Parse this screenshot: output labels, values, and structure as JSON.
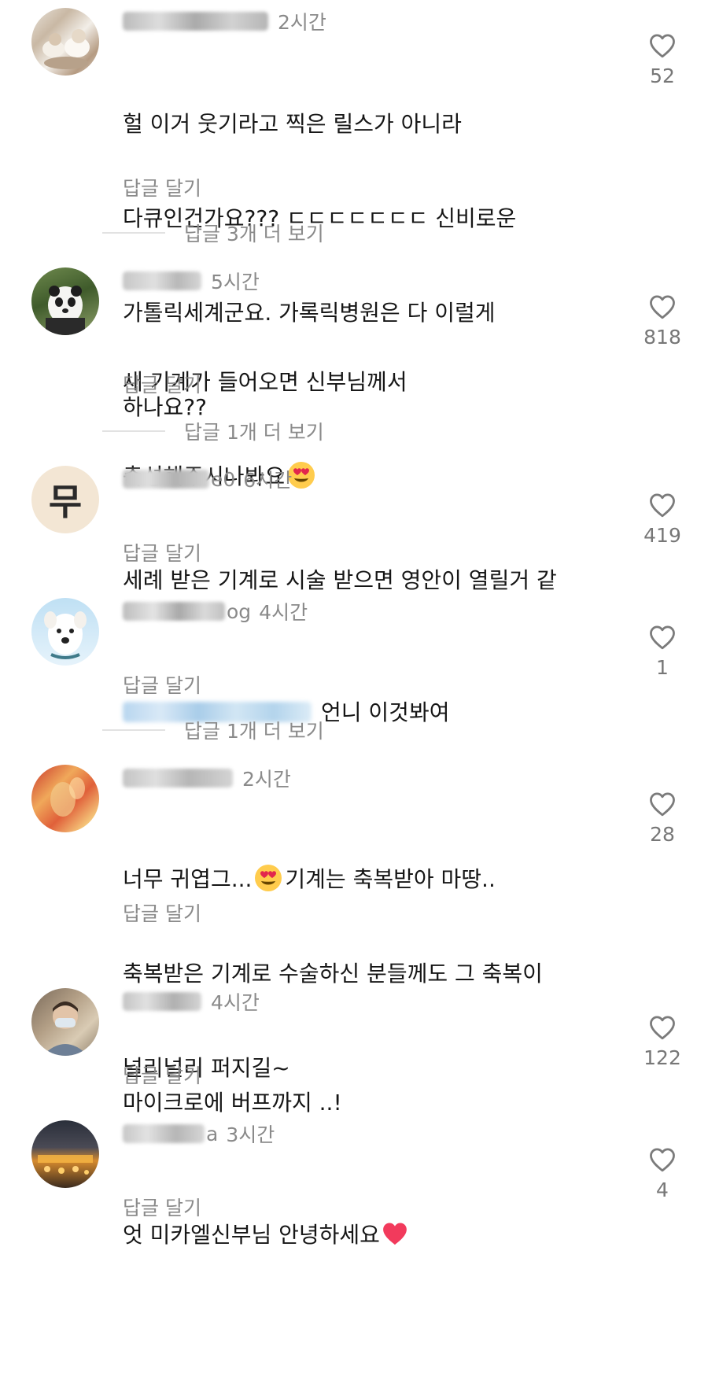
{
  "reply_label": "답글 달기",
  "comments": [
    {
      "user_visible": "",
      "time": "2시간",
      "lines": [
        "헐 이거 웃기라고 찍은 릴스가 아니라",
        "다큐인건가요??? ㄷㄷㄷㄷㄷㄷㄷ 신비로운",
        "가톨릭세계군요. 가록릭병원은 다 이럴게",
        "하나요??"
      ],
      "likes": "52",
      "more_replies": "답글 3개 더 보기"
    },
    {
      "user_visible": "",
      "time": "5시간",
      "lines": [
        "새 기계가 들어오면 신부님께서",
        "축성해주시나봐요"
      ],
      "likes": "818",
      "more_replies": "답글 1개 더 보기"
    },
    {
      "user_visible": "e0",
      "time": "6시간",
      "avatar_text": "무",
      "lines": [
        "세례 받은 기계로 시술 받으면 영안이 열릴거 같"
      ],
      "likes": "419"
    },
    {
      "user_visible": "og",
      "time": "4시간",
      "lines": [
        "언니 이것봐여"
      ],
      "likes": "1",
      "more_replies": "답글 1개 더 보기"
    },
    {
      "user_visible": "",
      "time": "2시간",
      "lines": [
        "너무 귀엽그...",
        "기계는 축복받아 마땅..",
        "축복받은 기계로 수술하신 분들께도 그 축복이",
        "널리널리 퍼지길~"
      ],
      "likes": "28"
    },
    {
      "user_visible": "",
      "time": "4시간",
      "lines": [
        "마이크로에 버프까지 ..!"
      ],
      "likes": "122"
    },
    {
      "user_visible": "a",
      "time": "3시간",
      "lines": [
        "엇 미카엘신부님 안녕하세요"
      ],
      "likes": "4"
    }
  ],
  "colors": {
    "secondary_text": "#8a8a8a",
    "body_text": "#161616",
    "divider": "#e2e2e2"
  },
  "icons": [
    "heart-outline-icon",
    "heart-eyes-emoji",
    "red-heart-emoji"
  ]
}
